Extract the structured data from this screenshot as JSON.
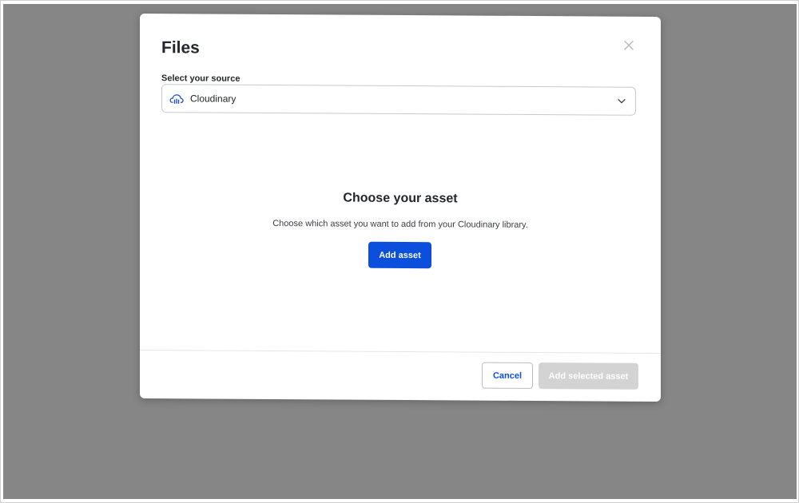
{
  "modal": {
    "title": "Files",
    "close_icon": "close-icon"
  },
  "source": {
    "label": "Select your source",
    "selected": "Cloudinary",
    "icon": "cloudinary-cloud-icon",
    "dropdown_icon": "chevron-down-icon"
  },
  "empty_state": {
    "title": "Choose your asset",
    "description": "Choose which asset you want to add from your Cloudinary library.",
    "add_button": "Add asset"
  },
  "footer": {
    "cancel_label": "Cancel",
    "add_selected_label": "Add selected asset"
  },
  "colors": {
    "overlay": "#868686",
    "primary": "#0b4fdc",
    "disabled": "#d3d3d3",
    "text": "#23252a"
  }
}
